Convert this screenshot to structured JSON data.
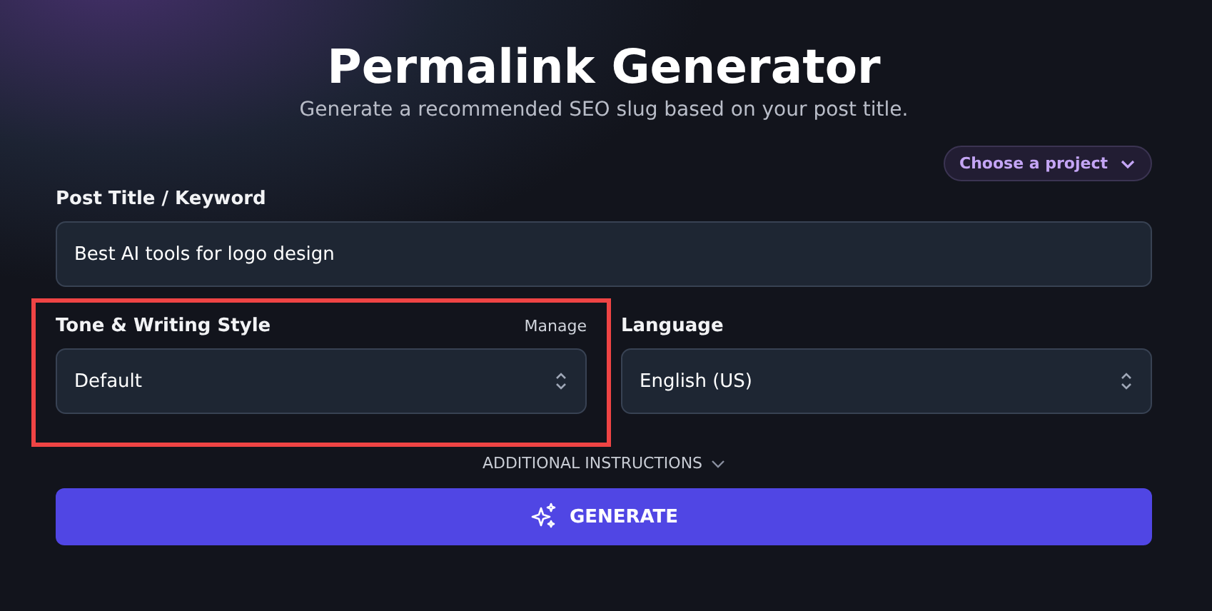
{
  "header": {
    "title": "Permalink Generator",
    "subtitle": "Generate a recommended SEO slug based on your post title."
  },
  "project_picker": {
    "label": "Choose a project"
  },
  "post_title": {
    "label": "Post Title / Keyword",
    "value": "Best AI tools for logo design"
  },
  "tone": {
    "label": "Tone & Writing Style",
    "manage_link": "Manage",
    "value": "Default",
    "highlighted": true
  },
  "language": {
    "label": "Language",
    "value": "English (US)"
  },
  "additional_instructions": {
    "label": "ADDITIONAL INSTRUCTIONS",
    "expanded": false
  },
  "generate_button": {
    "label": "GENERATE"
  }
}
